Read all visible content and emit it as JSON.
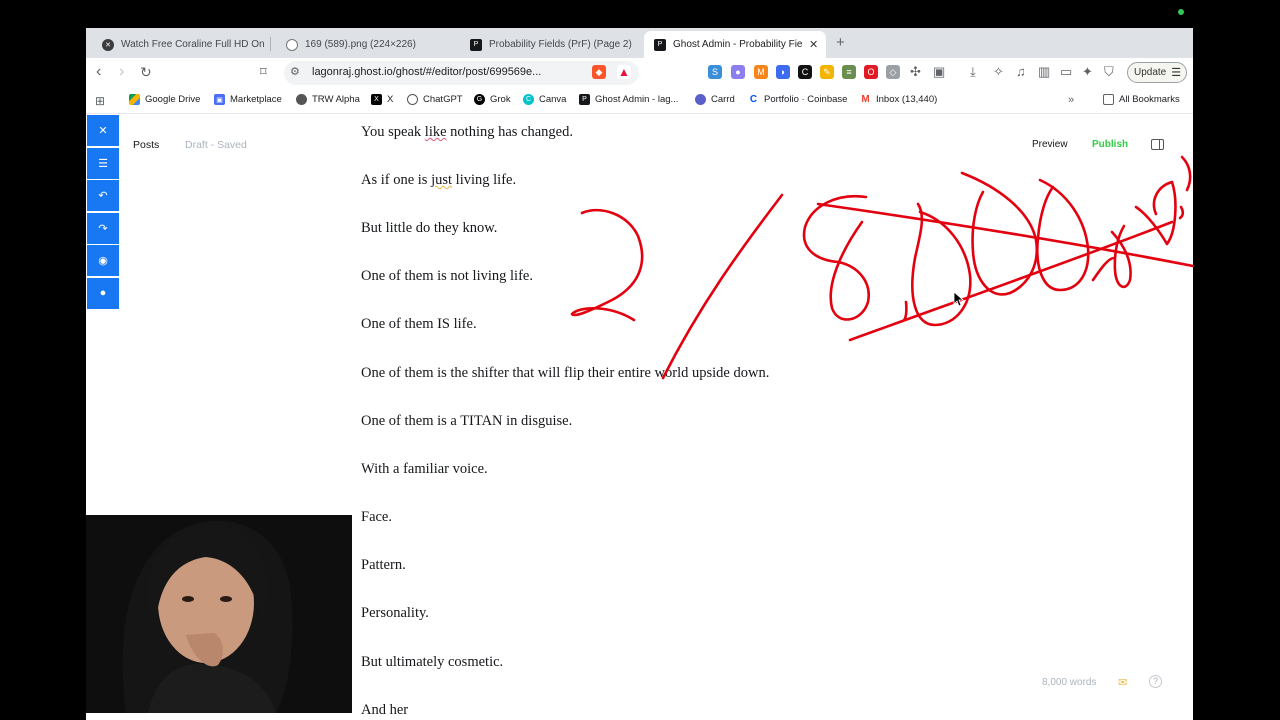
{
  "browser": {
    "tabs": [
      {
        "title": "Watch Free Coraline Full HD Online",
        "active": false
      },
      {
        "title": "169 (589).png (224×226)",
        "active": false
      },
      {
        "title": "Probability Fields (PrF) (Page 2)",
        "active": false
      },
      {
        "title": "Ghost Admin - Probability Fields",
        "active": true
      }
    ],
    "url": "lagonraj.ghost.io/ghost/#/editor/post/699569e...",
    "update_label": "Update",
    "bookmarks": [
      "Google Drive",
      "Marketplace",
      "TRW Alpha",
      "X",
      "ChatGPT",
      "Grok",
      "Canva",
      "Ghost Admin - lag...",
      "Carrd",
      "Portfolio · Coinbase",
      "Inbox (13,440)"
    ],
    "all_bookmarks_label": "All Bookmarks"
  },
  "editor": {
    "posts_label": "Posts",
    "status": "Draft - Saved",
    "preview_label": "Preview",
    "publish_label": "Publish",
    "word_count": "8,000 words",
    "paragraphs": [
      "You speak like nothing has changed.",
      "As if one is just living life.",
      "But little do they know.",
      "One of them is not living life.",
      "One of them IS life.",
      "One of them is the shifter that will flip their entire world upside down.",
      "One of them is a TITAN in disguise.",
      "With a familiar voice.",
      "Face.",
      "Pattern.",
      "Personality.",
      "But ultimately cosmetic.",
      "And her"
    ]
  },
  "colors": {
    "ink": "#e3000f",
    "palette": "#1877f2",
    "publish": "#30cf43"
  }
}
